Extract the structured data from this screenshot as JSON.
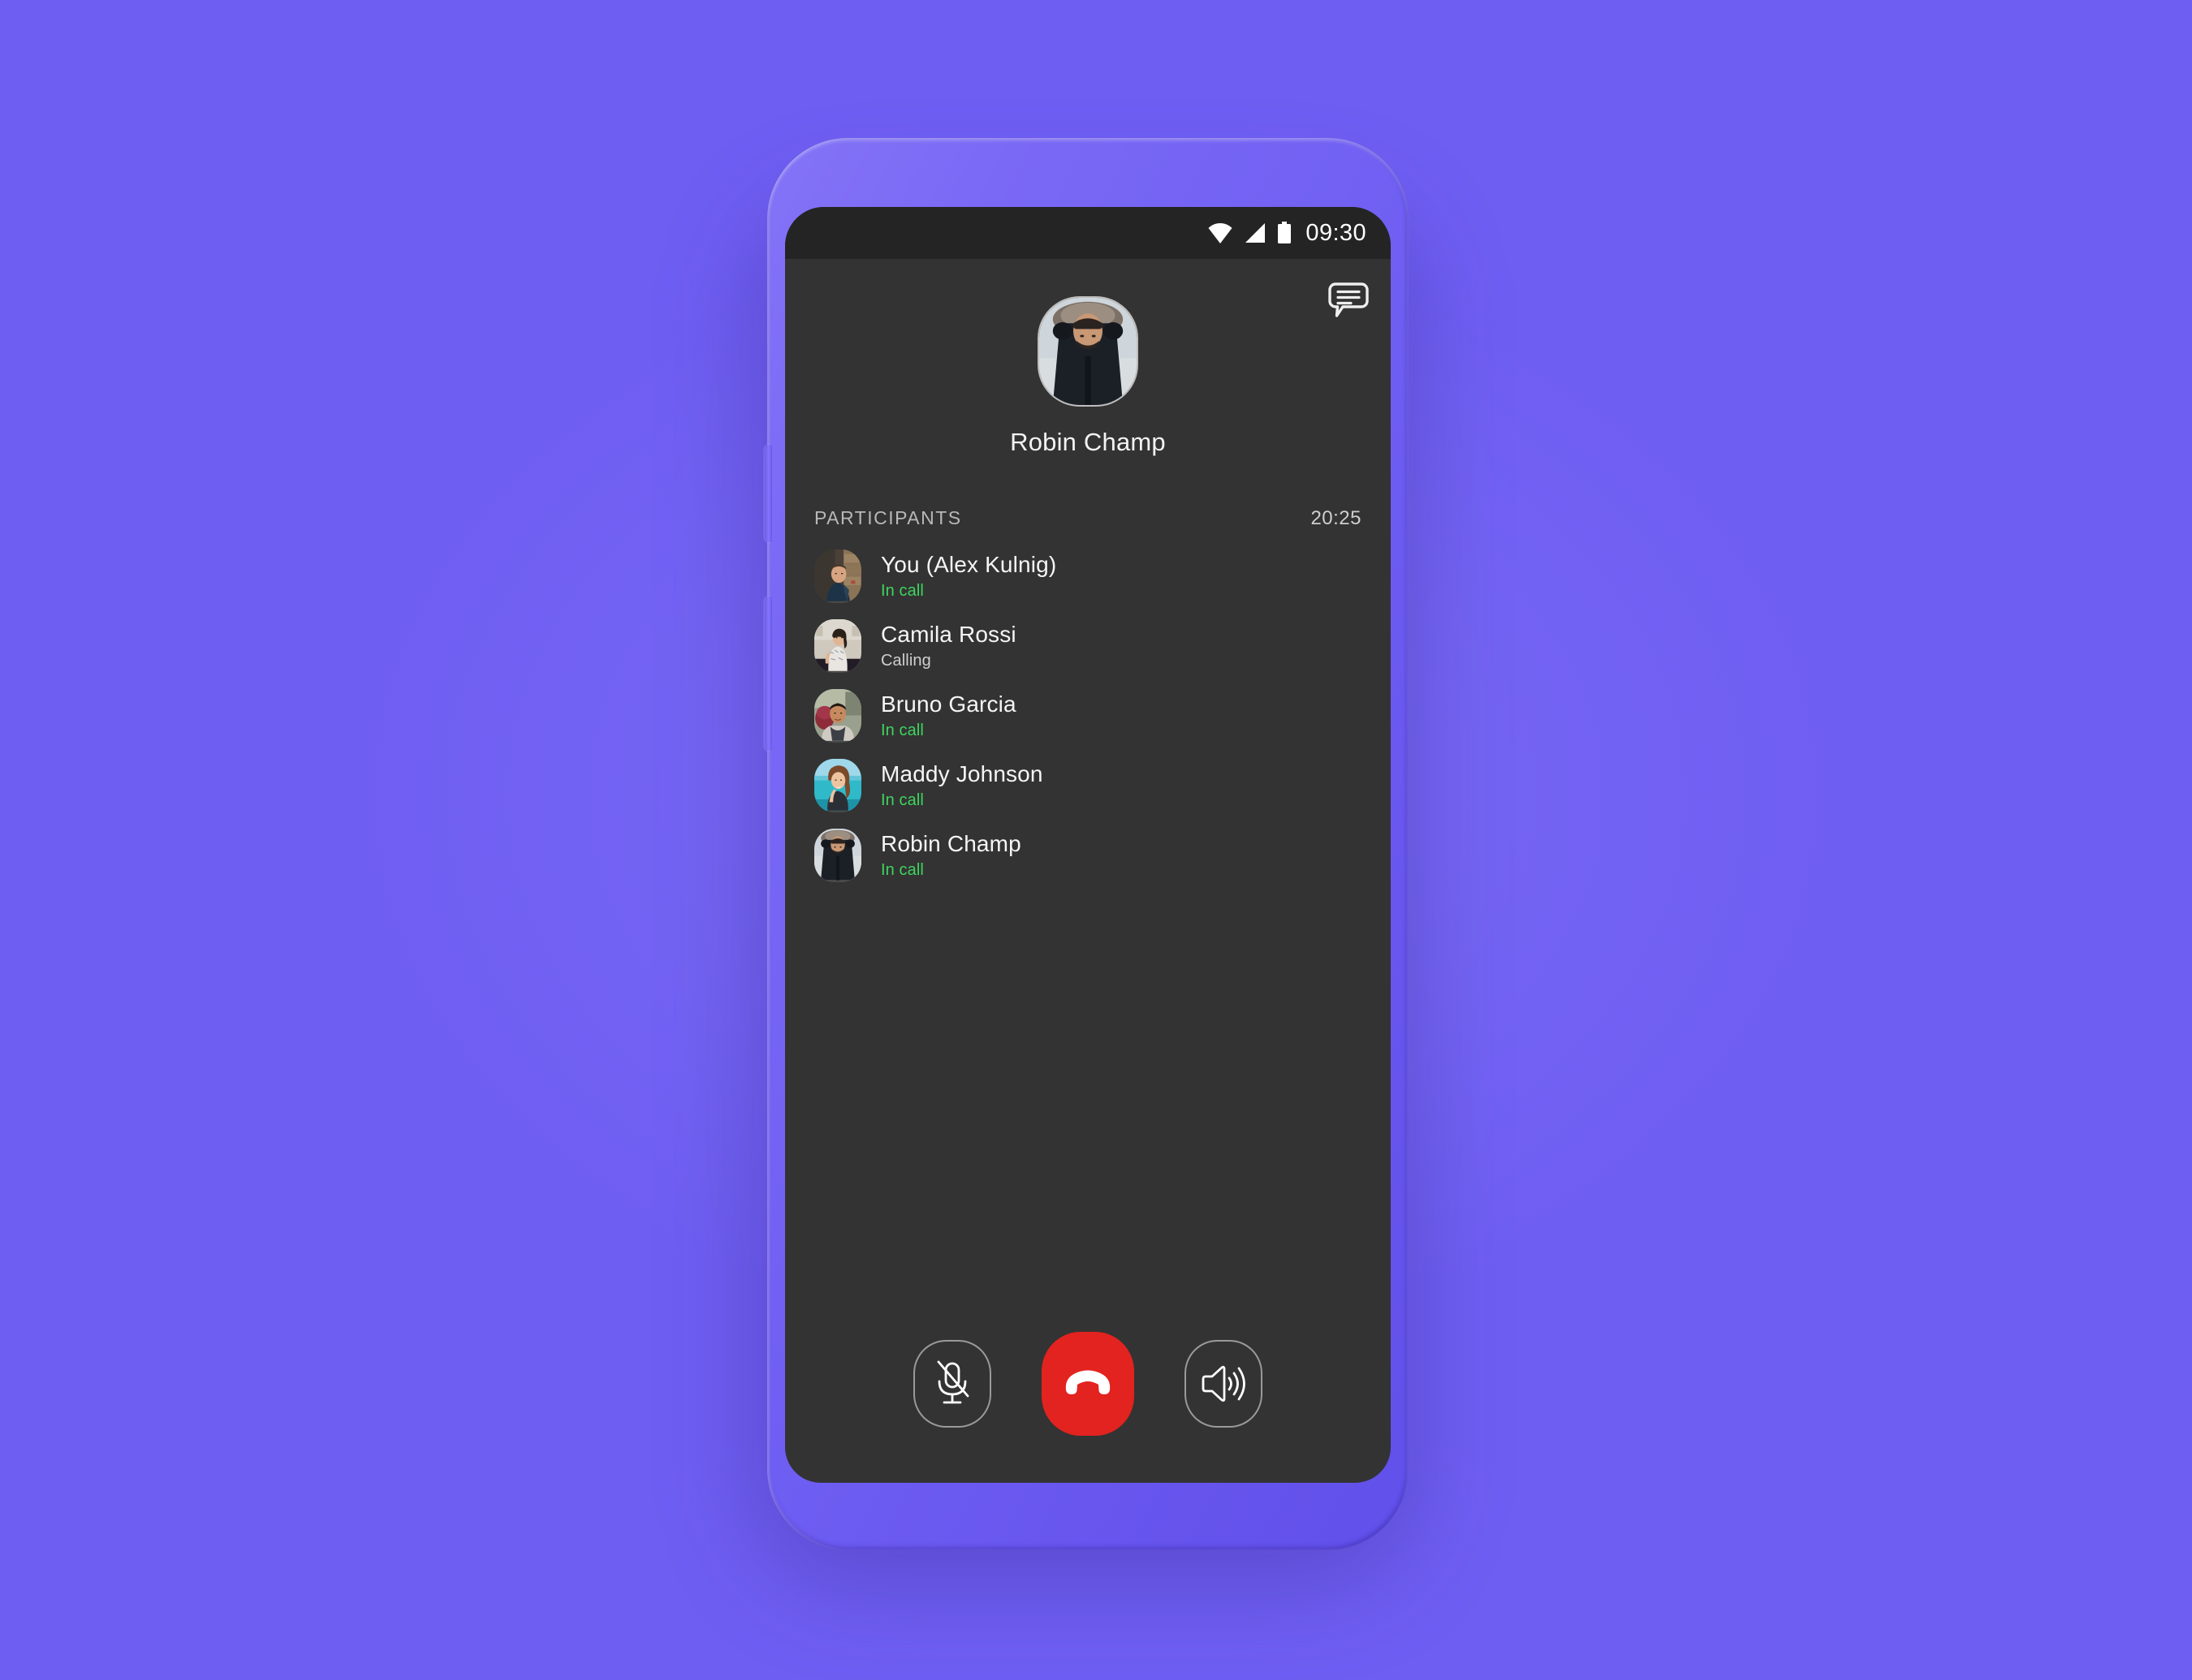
{
  "theme": {
    "background": "#6f5ef2",
    "phone_body": "#7a69f5",
    "screen_bg": "#333333",
    "status_bar_bg": "#242424",
    "accent_green": "#3fd45f",
    "end_call_red": "#e2231f",
    "text_primary": "#f5f5f5",
    "text_secondary": "#cfcfcf"
  },
  "status_bar": {
    "time": "09:30",
    "icons": [
      "wifi-icon",
      "signal-icon",
      "battery-icon"
    ]
  },
  "header": {
    "chat_icon": "chat-bubble-icon",
    "caller_name": "Robin Champ",
    "caller_avatar": "avatar-robin-champ"
  },
  "participants_section": {
    "label": "PARTICIPANTS",
    "timer": "20:25",
    "items": [
      {
        "name": "You (Alex Kulnig)",
        "status": "In call",
        "state": "incall",
        "avatar": "avatar-alex-kulnig"
      },
      {
        "name": "Camila Rossi",
        "status": "Calling",
        "state": "calling",
        "avatar": "avatar-camila-rossi"
      },
      {
        "name": "Bruno Garcia",
        "status": "In call",
        "state": "incall",
        "avatar": "avatar-bruno-garcia"
      },
      {
        "name": "Maddy Johnson",
        "status": "In call",
        "state": "incall",
        "avatar": "avatar-maddy-johnson"
      },
      {
        "name": "Robin Champ",
        "status": "In call",
        "state": "incall",
        "avatar": "avatar-robin-champ"
      }
    ]
  },
  "controls": {
    "mute": {
      "icon": "microphone-muted-icon",
      "label": "Mute"
    },
    "end_call": {
      "icon": "end-call-icon",
      "label": "End call"
    },
    "speaker": {
      "icon": "speaker-icon",
      "label": "Speaker"
    }
  }
}
